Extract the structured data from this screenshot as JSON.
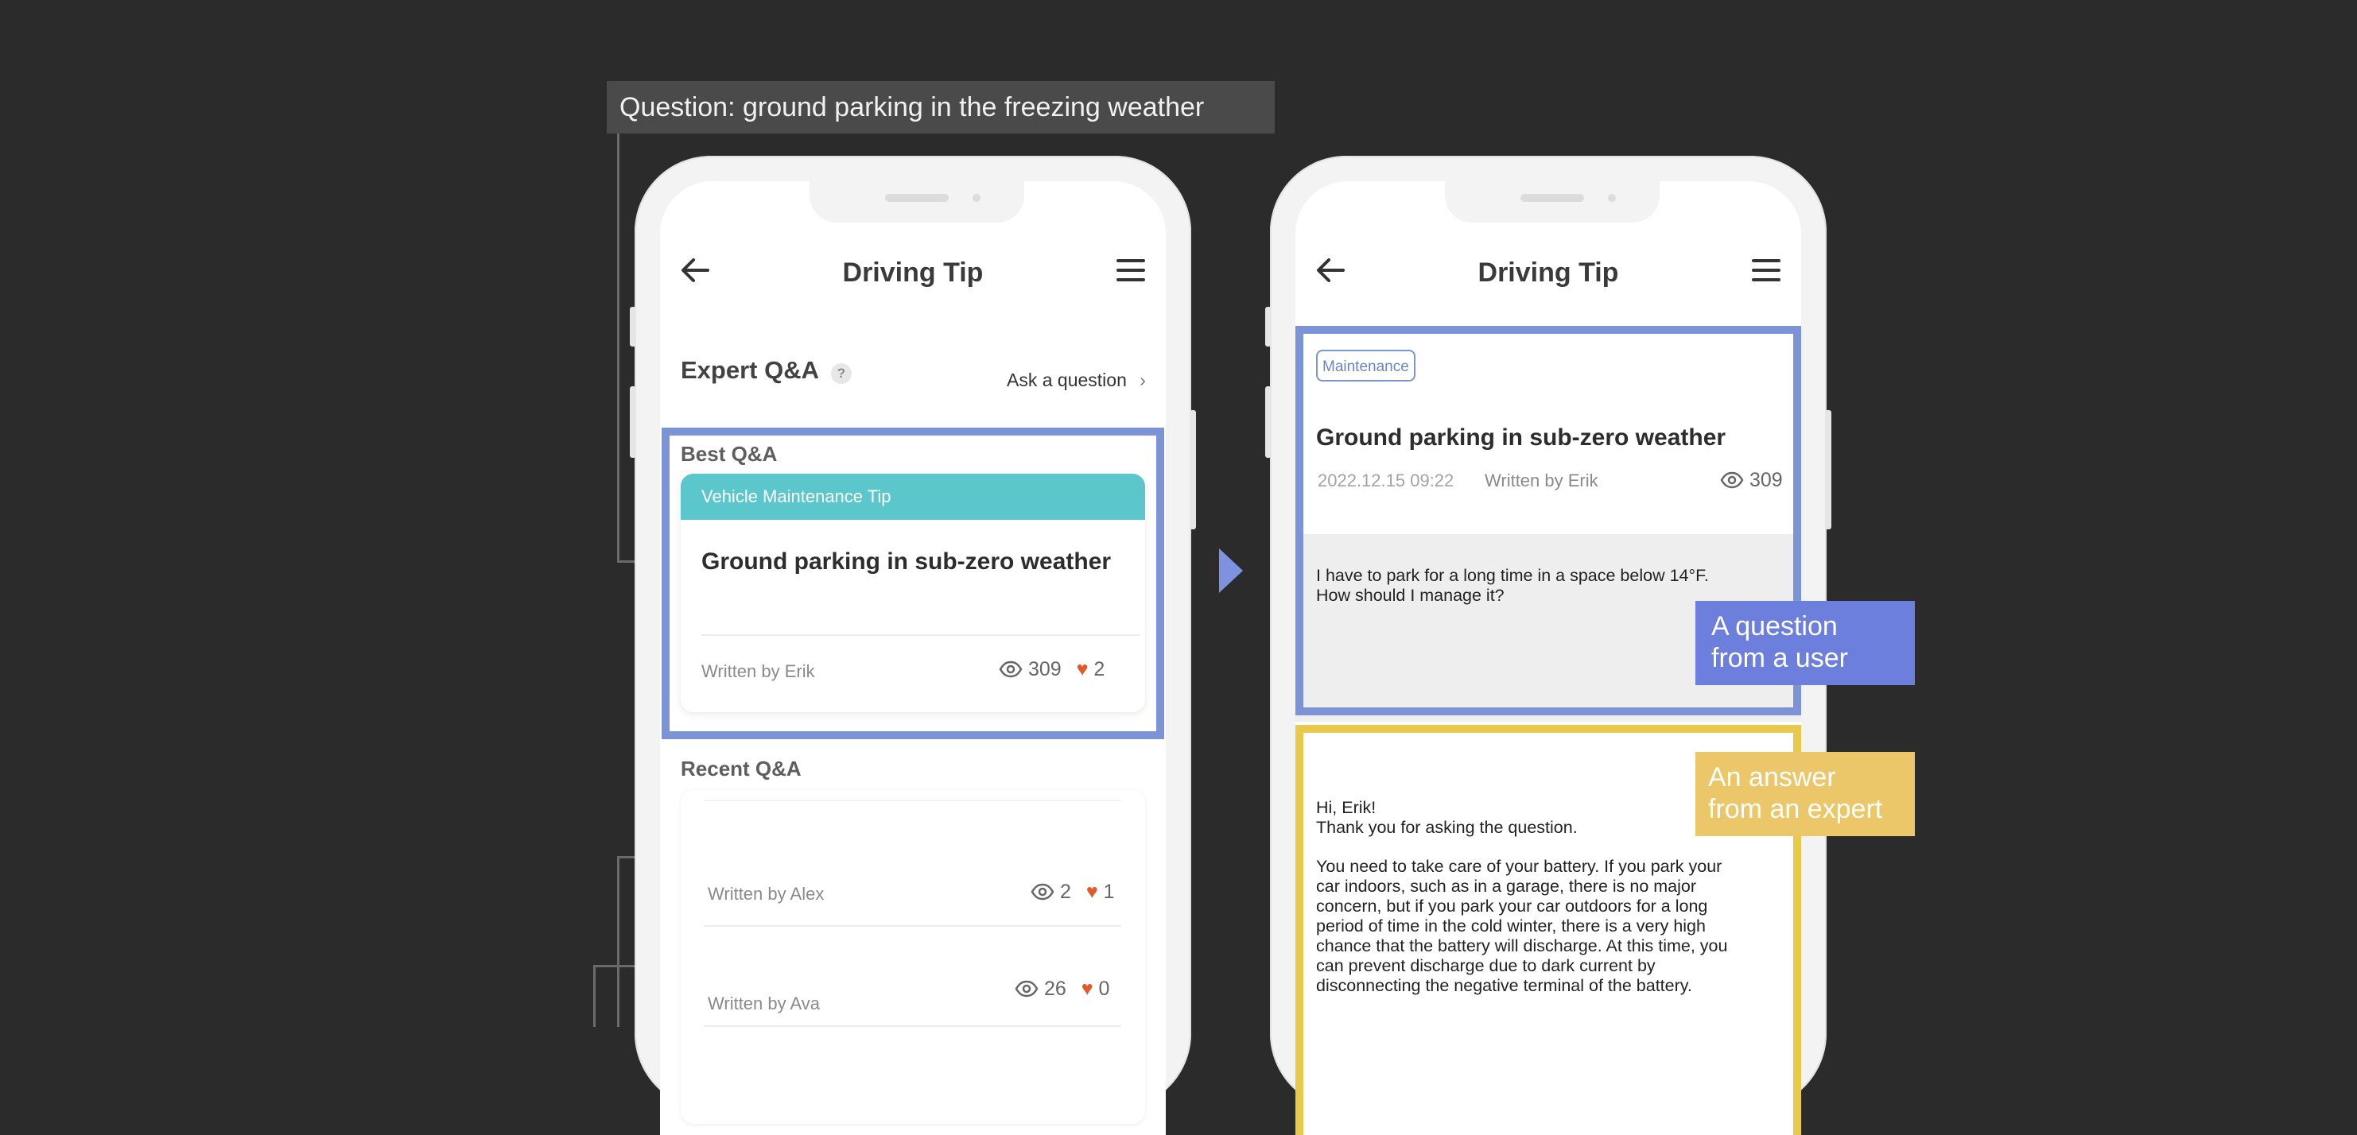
{
  "caption": "Question: ground parking in the freezing weather",
  "colors": {
    "background": "#2b2b2b",
    "highlight_blue": "#7c94d5",
    "highlight_yellow": "#e9c94c",
    "band_teal": "#5bc6cb",
    "heart": "#e25a2a",
    "callout_blue": "#6d7fdc",
    "callout_yellow": "#ebc76a"
  },
  "left_phone": {
    "nav": {
      "title": "Driving Tip",
      "back_icon": "arrow-left-icon",
      "menu_icon": "hamburger-icon"
    },
    "expert": {
      "title": "Expert Q&A",
      "help": "?",
      "ask_link": "Ask a question",
      "ask_chevron": "›"
    },
    "best": {
      "title": "Best Q&A",
      "card": {
        "category": "Vehicle Maintenance Tip",
        "title": "Ground parking in sub-zero weather",
        "author": "Written by Erik",
        "views": "309",
        "likes": "2"
      }
    },
    "recent": {
      "title": "Recent Q&A",
      "items": [
        {
          "author": "Written by Alex",
          "views": "2",
          "likes": "1"
        },
        {
          "author": "Written by Ava",
          "views": "26",
          "likes": "0"
        }
      ]
    }
  },
  "right_phone": {
    "nav": {
      "title": "Driving Tip"
    },
    "question": {
      "tag": "Maintenance",
      "title": "Ground parking in sub-zero weather",
      "date": "2022.12.15 09:22",
      "author": "Written by Erik",
      "views": "309",
      "body_line1": "I have to park for a long time in a space below 14°F.",
      "body_line2": "How should I manage it?"
    },
    "answer": {
      "greeting": "Hi, Erik!",
      "thanks": "Thank you for asking the question.",
      "body_lines": [
        "You need to take care of your battery. If you park your",
        "car indoors, such as in a garage, there is no major",
        "concern, but if you park your car outdoors for a long",
        "period of time in the cold winter, there is a very high",
        "chance that the battery will discharge. At this time, you",
        "can prevent discharge due to dark current by",
        "disconnecting the negative terminal of the battery."
      ]
    }
  },
  "callouts": {
    "question_line1": "A question",
    "question_line2": "from a user",
    "answer_line1": "An answer",
    "answer_line2": "from an expert"
  }
}
